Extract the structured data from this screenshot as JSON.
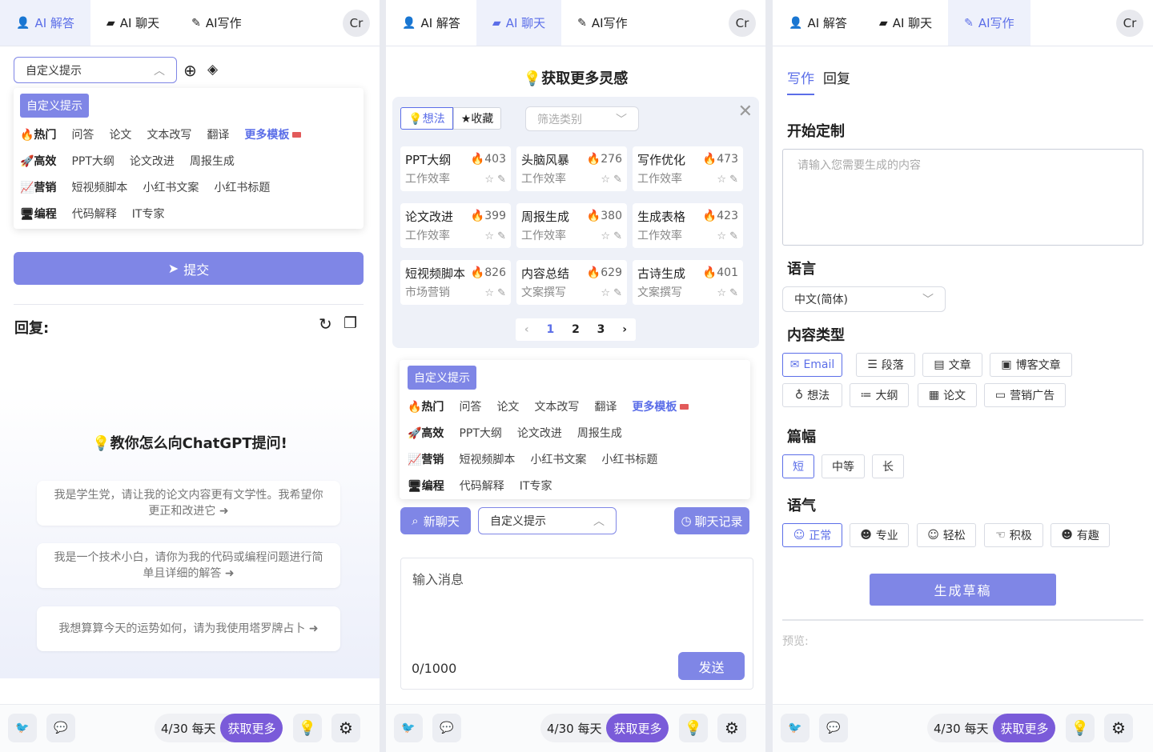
{
  "tabs": {
    "answer": "AI 解答",
    "chat": "AI 聊天",
    "write": "AI写作"
  },
  "avatar": "Cr",
  "footer": {
    "quota": "4/30 每天",
    "get_more": "获取更多"
  },
  "custom_prompt": "自定义提示",
  "dropdown": {
    "header": "自定义提示",
    "rows": [
      {
        "cat": "🔥热门",
        "items": [
          "问答",
          "论文",
          "文本改写",
          "翻译"
        ],
        "more": "更多模板"
      },
      {
        "cat": "🚀高效",
        "items": [
          "PPT大纲",
          "论文改进",
          "周报生成"
        ]
      },
      {
        "cat": "📈营销",
        "items": [
          "短视频脚本",
          "小红书文案",
          "小红书标题"
        ]
      },
      {
        "cat": "🖥编程",
        "items": [
          "代码解释",
          "IT专家"
        ]
      }
    ]
  },
  "panel1": {
    "submit": "提交",
    "reply_label": "回复:",
    "headline": "💡教你怎么向ChatGPT提问!",
    "suggestions": [
      "我是学生党，请让我的论文内容更有文学性。我希望你更正和改进它 ➜",
      "我是一个技术小白，请你为我的代码或编程问题进行简单且详细的解答 ➜",
      "我想算算今天的运势如何，请为我使用塔罗牌占卜 ➜"
    ]
  },
  "panel2": {
    "headline": "💡获取更多灵感",
    "tab_idea": "💡想法",
    "tab_fav": "★收藏",
    "filter_placeholder": "筛选类别",
    "cards": [
      {
        "title": "PPT大纲",
        "heat": "🔥403",
        "cat": "工作效率"
      },
      {
        "title": "头脑风暴",
        "heat": "🔥276",
        "cat": "工作效率"
      },
      {
        "title": "写作优化",
        "heat": "🔥473",
        "cat": "工作效率"
      },
      {
        "title": "论文改进",
        "heat": "🔥399",
        "cat": "工作效率"
      },
      {
        "title": "周报生成",
        "heat": "🔥380",
        "cat": "工作效率"
      },
      {
        "title": "生成表格",
        "heat": "🔥423",
        "cat": "工作效率"
      },
      {
        "title": "短视频脚本",
        "heat": "🔥826",
        "cat": "市场营销"
      },
      {
        "title": "内容总结",
        "heat": "🔥629",
        "cat": "文案撰写"
      },
      {
        "title": "古诗生成",
        "heat": "🔥401",
        "cat": "文案撰写"
      }
    ],
    "pages": [
      "1",
      "2",
      "3"
    ],
    "new_chat": "新聊天",
    "history": "聊天记录",
    "input_placeholder": "输入消息",
    "counter": "0/1000",
    "send": "发送"
  },
  "panel3": {
    "subtab_write": "写作",
    "subtab_reply": "回复",
    "start_title": "开始定制",
    "content_placeholder": "请输入您需要生成的内容",
    "lang_title": "语言",
    "lang_value": "中文(简体)",
    "type_title": "内容类型",
    "types": [
      "Email",
      "段落",
      "文章",
      "博客文章",
      "想法",
      "大纲",
      "论文",
      "营销广告"
    ],
    "length_title": "篇幅",
    "lengths": [
      "短",
      "中等",
      "长"
    ],
    "tone_title": "语气",
    "tones": [
      "正常",
      "专业",
      "轻松",
      "积极",
      "有趣"
    ],
    "generate": "生成草稿",
    "preview": "预览:"
  },
  "colors": {
    "accent": "#5b6ee8",
    "button": "#7f86e6",
    "get_more": "#7a5bd9"
  }
}
